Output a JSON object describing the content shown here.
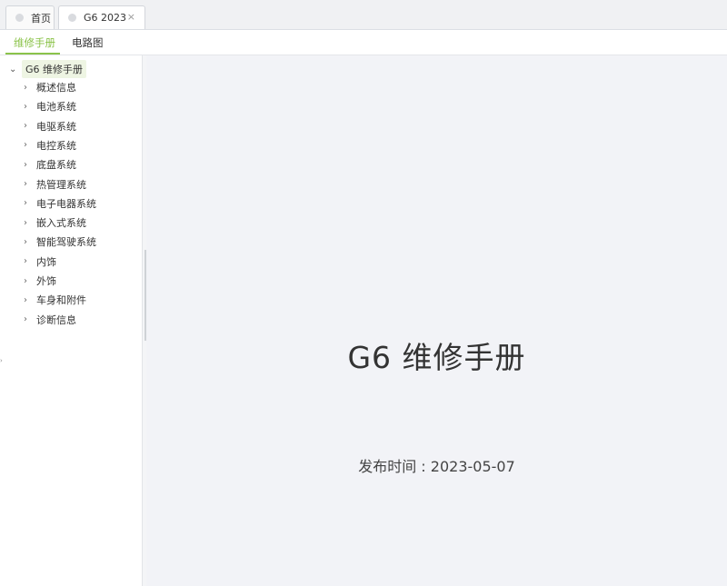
{
  "tabs": [
    {
      "label": "首页",
      "closable": false
    },
    {
      "label": "G6 2023",
      "closable": true,
      "close_glyph": "×"
    }
  ],
  "subtabs": [
    {
      "label": "维修手册",
      "active": true
    },
    {
      "label": "电路图",
      "active": false
    }
  ],
  "tree": {
    "root": "G6 维修手册",
    "items": [
      "概述信息",
      "电池系统",
      "电驱系统",
      "电控系统",
      "底盘系统",
      "热管理系统",
      "电子电器系统",
      "嵌入式系统",
      "智能驾驶系统",
      "内饰",
      "外饰",
      "车身和附件",
      "诊断信息"
    ]
  },
  "document": {
    "title": "G6 维修手册",
    "publish_date": "发布时间 : 2023-05-07"
  },
  "colors": {
    "accent": "#8bc34a",
    "content_bg": "#f2f3f7"
  }
}
